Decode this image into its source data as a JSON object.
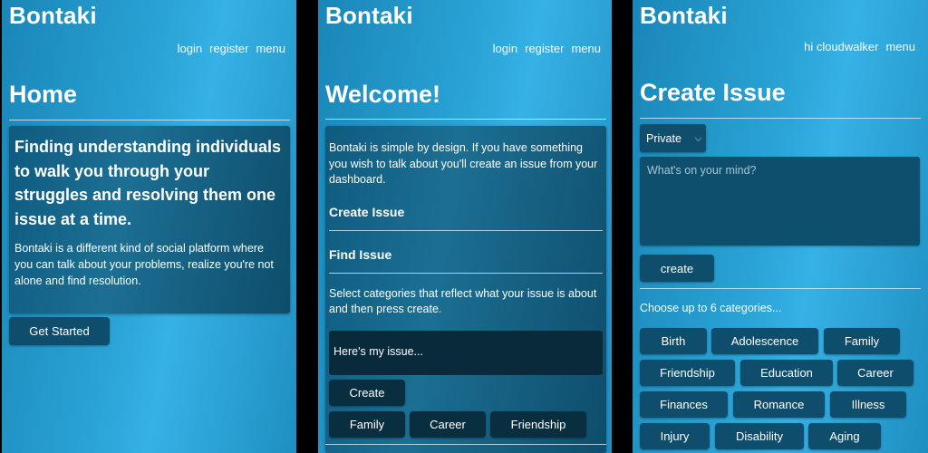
{
  "screen1": {
    "brand": "Bontaki",
    "nav": [
      "login",
      "register",
      "menu"
    ],
    "title": "Home",
    "card_headline": "Finding understanding individuals to walk you through your struggles and resolving them one issue at a time.",
    "card_body": "Bontaki is a different kind of social platform where you can talk about your problems, realize you're not alone and find resolution.",
    "cta": "Get Started"
  },
  "screen2": {
    "brand": "Bontaki",
    "nav": [
      "login",
      "register",
      "menu"
    ],
    "title": "Welcome!",
    "intro": "Bontaki is simple by design. If you have something you wish to talk about you'll create an issue from your dashboard.",
    "section_create": "Create Issue",
    "section_find": "Find Issue",
    "categories_text": "Select categories that reflect what your issue is about and then press create.",
    "issue_placeholder": "Here's my issue...",
    "create_button": "Create",
    "categories": [
      "Family",
      "Career",
      "Friendship"
    ]
  },
  "screen3": {
    "brand": "Bontaki",
    "greeting": "hi cloudwalker",
    "menu": "menu",
    "title": "Create Issue",
    "visibility": "Private",
    "textarea_placeholder": "What's on your mind?",
    "create_button": "create",
    "choose_text": "Choose up to 6 categories...",
    "categories": [
      [
        "Birth",
        "Adolescence",
        "Family"
      ],
      [
        "Friendship",
        "Education",
        "Career"
      ],
      [
        "Finances",
        "Romance",
        "Illness"
      ],
      [
        "Injury",
        "Disability",
        "Aging"
      ]
    ]
  }
}
